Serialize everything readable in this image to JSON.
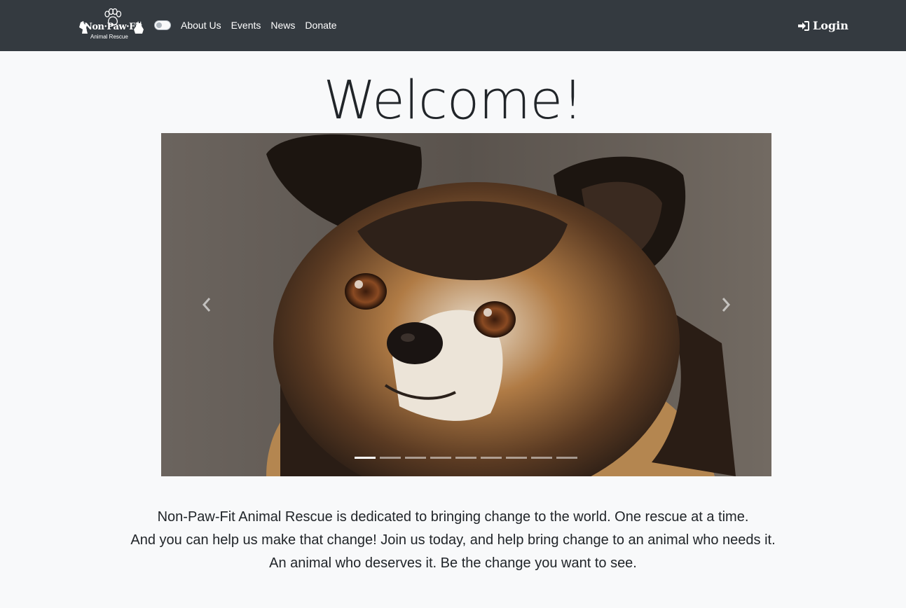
{
  "brand": {
    "name": "Non·Paw·Fit",
    "subtitle": "Animal Rescue"
  },
  "nav": {
    "links": [
      "About Us",
      "Events",
      "News",
      "Donate"
    ],
    "login_label": "Login"
  },
  "main": {
    "heading": "Welcome!",
    "carousel": {
      "slide_count": 9,
      "active_index": 0,
      "image_icon": "dog-photo",
      "prev_icon": "chevron-left-icon",
      "next_icon": "chevron-right-icon"
    },
    "intro_lines": [
      "Non-Paw-Fit Animal Rescue is dedicated to bringing change to the world. One rescue at a time.",
      "And you can help us make that change! Join us today, and help bring change to an animal who needs it.",
      "An animal who deserves it. Be the change you want to see."
    ]
  },
  "colors": {
    "navbar": "#343a40",
    "page_bg": "#f8f9fa",
    "text": "#212529"
  }
}
